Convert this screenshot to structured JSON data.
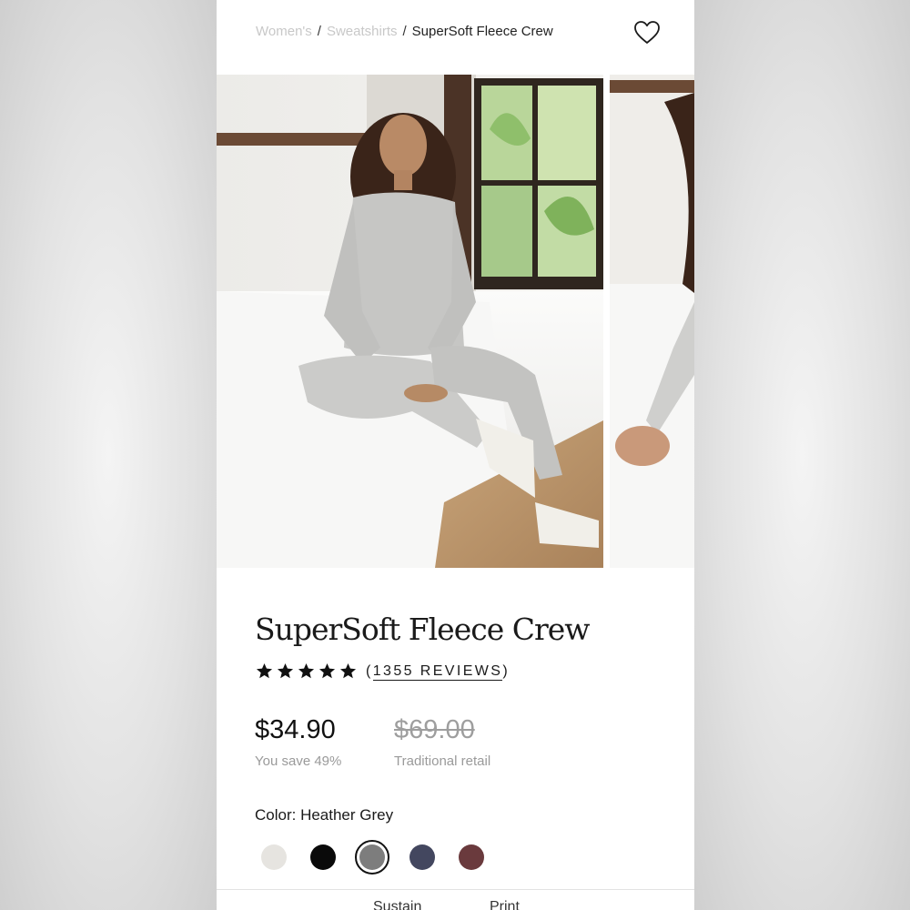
{
  "breadcrumb": {
    "items": [
      "Women's",
      "Sweatshirts"
    ],
    "separator": "/",
    "current": "SuperSoft Fleece Crew"
  },
  "product": {
    "title": "SuperSoft Fleece Crew",
    "rating_stars": 5,
    "reviews_open": "(",
    "reviews_label": "1355 REVIEWS",
    "reviews_close": ")",
    "price": "$34.90",
    "savings": "You save 49%",
    "retail_price": "$69.00",
    "retail_label": "Traditional retail",
    "color_label": "Color: Heather Grey"
  },
  "swatches": [
    {
      "name": "Cream",
      "color": "#e6e4e0",
      "selected": false
    },
    {
      "name": "Black",
      "color": "#0a0a0a",
      "selected": false
    },
    {
      "name": "Heather Grey",
      "color": "#7d7d7d",
      "selected": true
    },
    {
      "name": "Navy",
      "color": "#43475f",
      "selected": false
    },
    {
      "name": "Burgundy",
      "color": "#6a3a3d",
      "selected": false
    }
  ],
  "tabs": [
    "Sustain",
    "Print"
  ],
  "icons": {
    "favorite": "heart-outline-icon",
    "rating": "star-icon"
  }
}
